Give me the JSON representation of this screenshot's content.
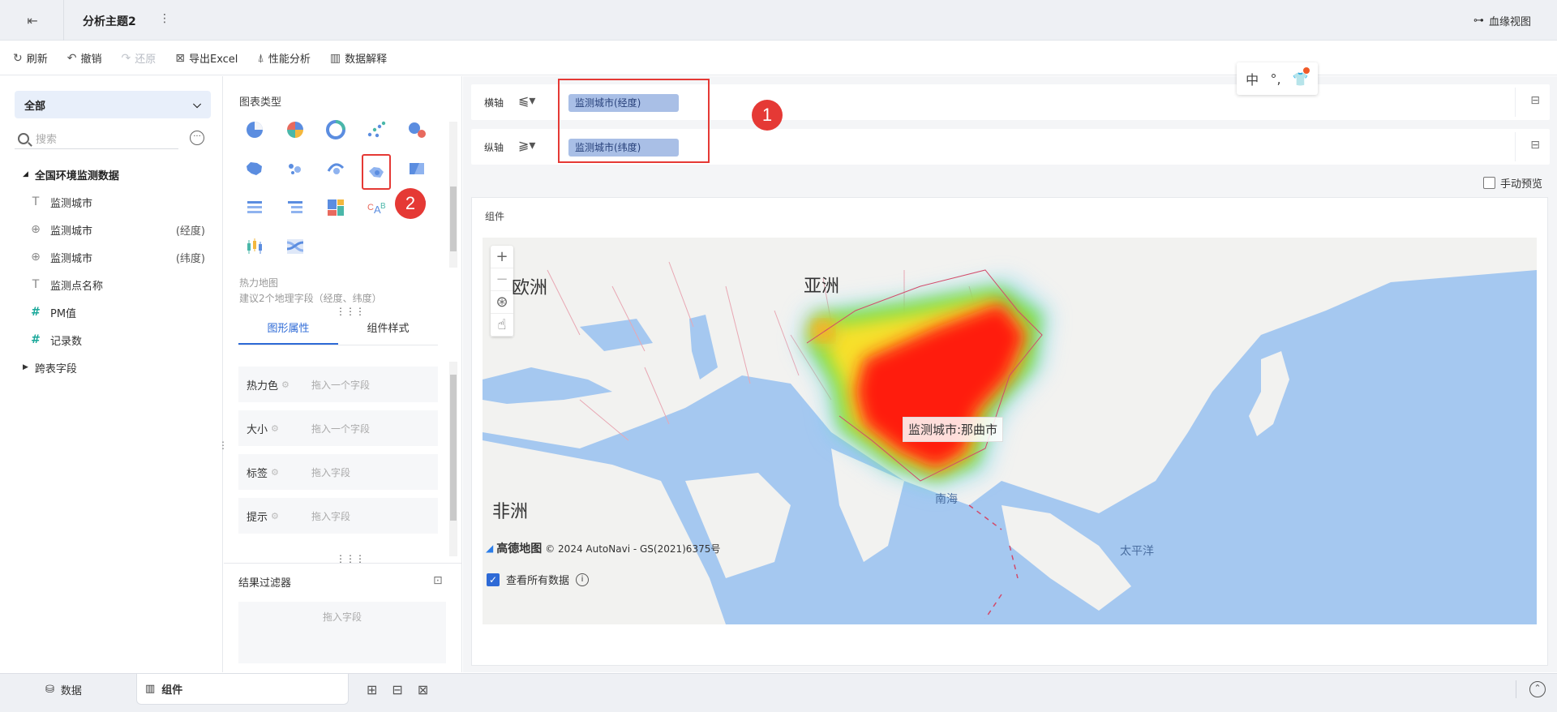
{
  "header": {
    "title": "分析主题2",
    "lineage_label": "血缘视图"
  },
  "toolbar": {
    "refresh": "刷新",
    "undo": "撤销",
    "redo": "还原",
    "export_excel": "导出Excel",
    "perf_analysis": "性能分析",
    "data_explain": "数据解释"
  },
  "left_panel": {
    "scope_select": "全部",
    "search_placeholder": "搜索",
    "dataset_group": "全国环境监测数据",
    "fields": [
      {
        "icon": "text-field-icon",
        "label": "监测城市",
        "suffix": ""
      },
      {
        "icon": "globe-icon",
        "label": "监测城市",
        "suffix": "(经度)"
      },
      {
        "icon": "globe-icon",
        "label": "监测城市",
        "suffix": "(纬度)"
      },
      {
        "icon": "text-field-icon",
        "label": "监测点名称",
        "suffix": ""
      },
      {
        "icon": "number-field-icon",
        "label": "PM值",
        "suffix": ""
      },
      {
        "icon": "calculated-number-icon",
        "label": "记录数",
        "suffix": ""
      }
    ],
    "cross_table_group": "跨表字段"
  },
  "middle_panel": {
    "chart_types_title": "图表类型",
    "selected_chart_name": "热力地图",
    "selected_chart_hint": "建议2个地理字段（经度、纬度）",
    "tabs": [
      "图形属性",
      "组件样式"
    ],
    "properties": [
      {
        "label": "热力色",
        "placeholder": "拖入一个字段"
      },
      {
        "label": "大小",
        "placeholder": "拖入一个字段"
      },
      {
        "label": "标签",
        "placeholder": "拖入字段"
      },
      {
        "label": "提示",
        "placeholder": "拖入字段"
      }
    ],
    "result_filter_title": "结果过滤器",
    "result_filter_placeholder": "拖入字段"
  },
  "axes": {
    "x_label": "横轴",
    "x_field": "监测城市(经度)",
    "y_label": "纵轴",
    "y_field": "监测城市(纬度)"
  },
  "annotations": {
    "badge1": "1",
    "badge2": "2"
  },
  "float_tools": {
    "lang": "中"
  },
  "manual_preview": "手动预览",
  "component": {
    "title": "组件",
    "map_labels": {
      "europe": "欧洲",
      "asia": "亚洲",
      "africa": "非洲",
      "south_sea": "南海",
      "pacific": "太平洋"
    },
    "tooltip": "监测城市:那曲市",
    "attribution_brand": "高德地图",
    "attribution_text": "© 2024 AutoNavi - GS(2021)6375号",
    "see_all_data": "查看所有数据"
  },
  "bottom_tabs": {
    "data": "数据",
    "component": "组件"
  },
  "colors": {
    "accent": "#2e6ad6",
    "highlight": "#e53935",
    "pill": "#a9bfe6",
    "sea": "#a5c8f0",
    "land": "#f2f2f0"
  }
}
